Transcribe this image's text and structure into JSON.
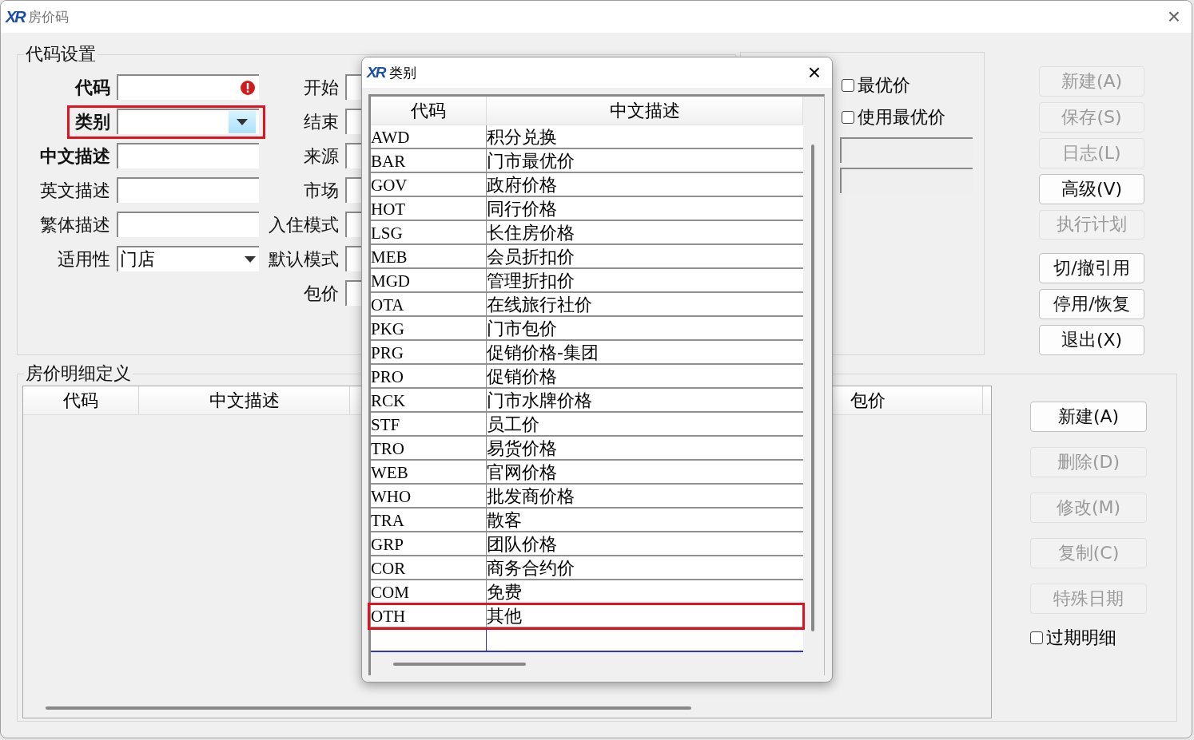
{
  "window": {
    "logo": "XR",
    "title": "房价码",
    "close": "×"
  },
  "code_settings": {
    "title": "代码设置",
    "fields": [
      {
        "label": "代码",
        "bold": true,
        "kind": "text",
        "error": true,
        "highlighted": false
      },
      {
        "label": "类别",
        "bold": true,
        "kind": "dropdown",
        "error": false,
        "highlighted": true
      },
      {
        "label": "中文描述",
        "bold": true,
        "kind": "text",
        "error": false,
        "highlighted": false
      },
      {
        "label": "英文描述",
        "bold": false,
        "kind": "text",
        "error": false,
        "highlighted": false
      },
      {
        "label": "繁体描述",
        "bold": false,
        "kind": "text",
        "error": false,
        "highlighted": false
      },
      {
        "label": "适用性",
        "bold": false,
        "kind": "select",
        "value": "门店",
        "error": false,
        "highlighted": false
      }
    ],
    "side_fields": [
      {
        "label": "开始"
      },
      {
        "label": "结束"
      },
      {
        "label": "来源"
      },
      {
        "label": "市场"
      },
      {
        "label": "入住模式"
      },
      {
        "label": "默认模式"
      },
      {
        "label": "包价"
      }
    ]
  },
  "best_price": {
    "checkboxes": [
      {
        "label": "最优价",
        "checked": false
      },
      {
        "label": "使用最优价",
        "checked": false
      }
    ]
  },
  "actions": [
    {
      "label": "新建(A)",
      "disabled": true,
      "separated": false
    },
    {
      "label": "保存(S)",
      "disabled": true,
      "separated": false
    },
    {
      "label": "日志(L)",
      "disabled": true,
      "separated": false
    },
    {
      "label": "高级(V)",
      "disabled": false,
      "separated": false
    },
    {
      "label": "执行计划",
      "disabled": true,
      "separated": false
    },
    {
      "label": "切/撤引用",
      "disabled": false,
      "separated": true
    },
    {
      "label": "停用/恢复",
      "disabled": false,
      "separated": false
    },
    {
      "label": "退出(X)",
      "disabled": false,
      "separated": false
    }
  ],
  "detail": {
    "title": "房价明细定义",
    "columns": [
      "代码",
      "中文描述",
      "包价"
    ],
    "actions": [
      {
        "label": "新建(A)",
        "disabled": false
      },
      {
        "label": "删除(D)",
        "disabled": true
      },
      {
        "label": "修改(M)",
        "disabled": true
      },
      {
        "label": "复制(C)",
        "disabled": true
      },
      {
        "label": "特殊日期",
        "disabled": true
      }
    ],
    "checkbox": {
      "label": "过期明细",
      "checked": false
    }
  },
  "dialog": {
    "logo": "XR",
    "title": "类别",
    "close": "×",
    "columns": [
      "代码",
      "中文描述"
    ],
    "rows": [
      {
        "code": "AWD",
        "desc": "积分兑换",
        "highlighted": false
      },
      {
        "code": "BAR",
        "desc": "门市最优价",
        "highlighted": false
      },
      {
        "code": "GOV",
        "desc": "政府价格",
        "highlighted": false
      },
      {
        "code": "HOT",
        "desc": "同行价格",
        "highlighted": false
      },
      {
        "code": "LSG",
        "desc": "长住房价格",
        "highlighted": false
      },
      {
        "code": "MEB",
        "desc": "会员折扣价",
        "highlighted": false
      },
      {
        "code": "MGD",
        "desc": "管理折扣价",
        "highlighted": false
      },
      {
        "code": "OTA",
        "desc": "在线旅行社价",
        "highlighted": false
      },
      {
        "code": "PKG",
        "desc": "门市包价",
        "highlighted": false
      },
      {
        "code": "PRG",
        "desc": "促销价格-集团",
        "highlighted": false
      },
      {
        "code": "PRO",
        "desc": "促销价格",
        "highlighted": false
      },
      {
        "code": "RCK",
        "desc": "门市水牌价格",
        "highlighted": false
      },
      {
        "code": "STF",
        "desc": "员工价",
        "highlighted": false
      },
      {
        "code": "TRO",
        "desc": "易货价格",
        "highlighted": false
      },
      {
        "code": "WEB",
        "desc": "官网价格",
        "highlighted": false
      },
      {
        "code": "WHO",
        "desc": "批发商价格",
        "highlighted": false
      },
      {
        "code": "TRA",
        "desc": "散客",
        "highlighted": false
      },
      {
        "code": "GRP",
        "desc": "团队价格",
        "highlighted": false
      },
      {
        "code": "COR",
        "desc": "商务合约价",
        "highlighted": false
      },
      {
        "code": "COM",
        "desc": "免费",
        "highlighted": false
      },
      {
        "code": "OTH",
        "desc": "其他",
        "highlighted": true
      }
    ]
  }
}
